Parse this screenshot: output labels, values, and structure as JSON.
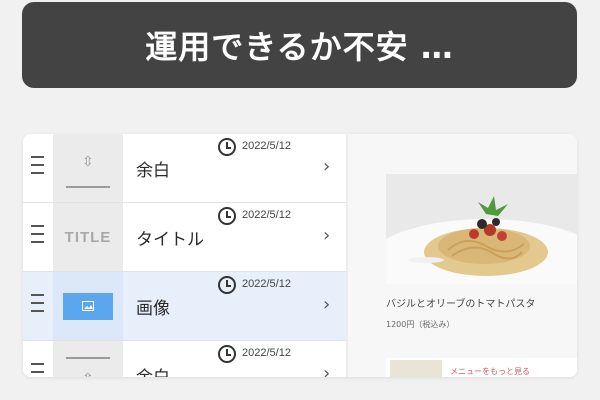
{
  "banner": {
    "text": "運用できるか不安 …"
  },
  "blocks": [
    {
      "label": "余白",
      "date": "2022/5/12",
      "type": "spacer",
      "selected": false
    },
    {
      "label": "タイトル",
      "date": "2022/5/12",
      "type": "title",
      "thumb_text": "TITLE",
      "selected": false
    },
    {
      "label": "画像",
      "date": "2022/5/12",
      "type": "image",
      "selected": true
    },
    {
      "label": "余白",
      "date": "2022/5/12",
      "type": "spacer",
      "selected": false
    }
  ],
  "preview": {
    "caption": "バジルとオリーブのトマトパスタ",
    "price": "1200円（税込み）",
    "next_item_text": "メニューをもっと見る"
  },
  "colors": {
    "banner_bg": "#434343",
    "selected_row": "#e7effb",
    "image_thumb": "#5aa7ee",
    "accent_text": "#d05a5a"
  },
  "icons": {
    "drag": "drag-handle-icon",
    "clock": "clock-icon",
    "chevron": "chevron-right-icon",
    "image": "image-icon",
    "spacer": "vertical-resize-icon"
  }
}
